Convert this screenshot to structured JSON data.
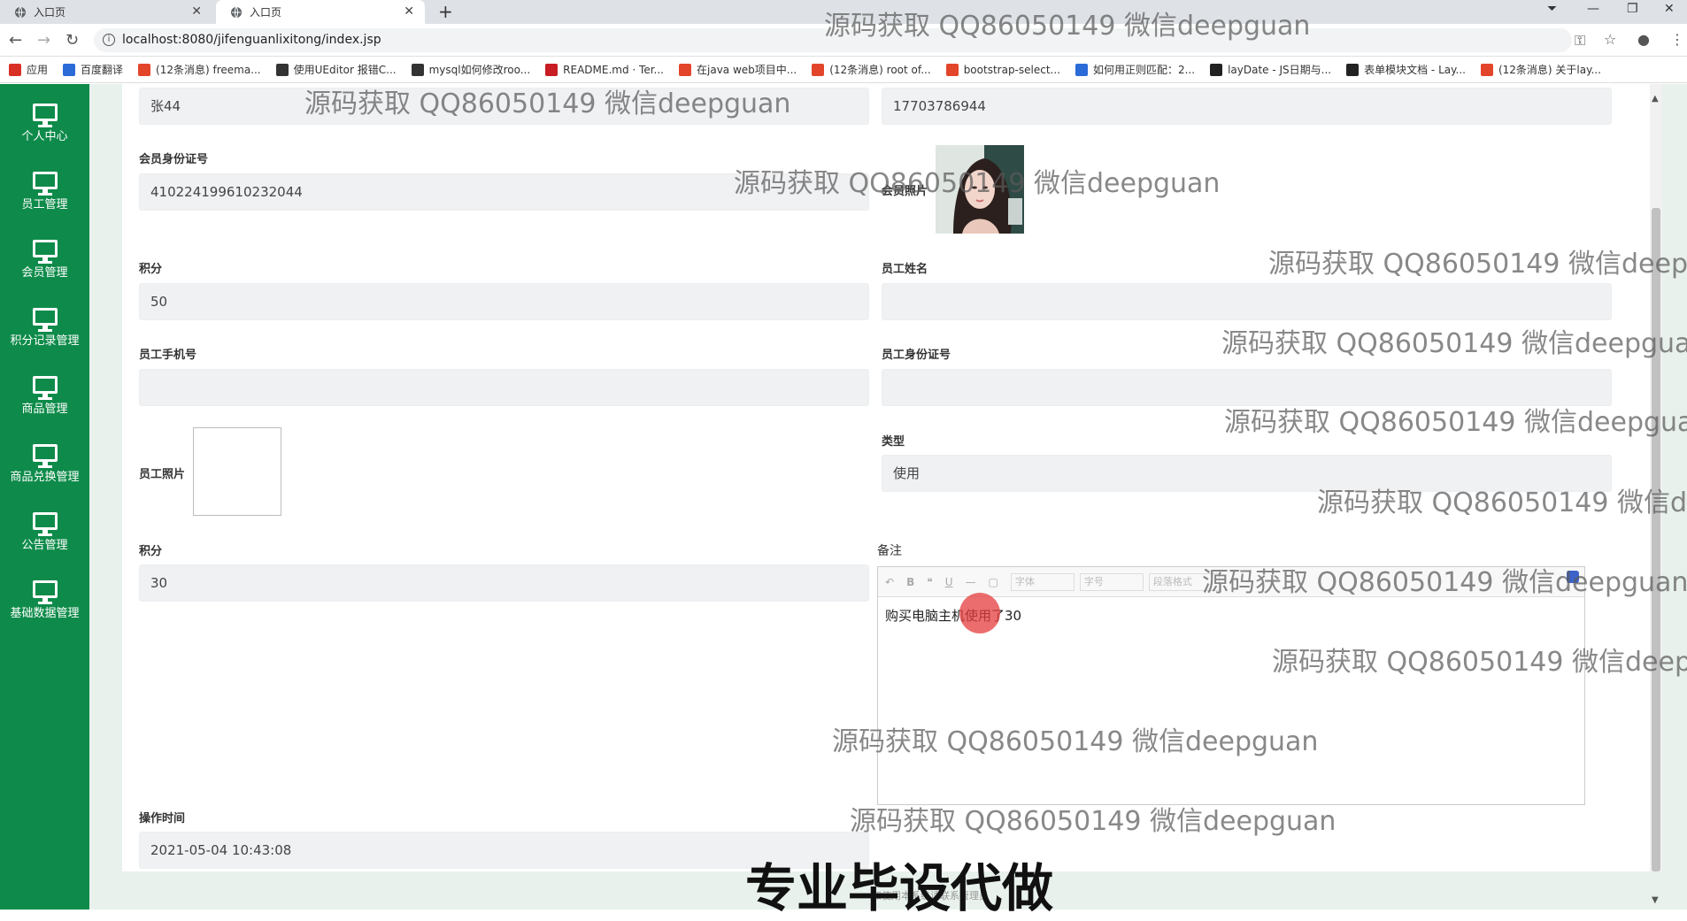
{
  "browser": {
    "tabs": [
      {
        "title": "入口页",
        "active": false
      },
      {
        "title": "入口页",
        "active": true
      }
    ],
    "url": "localhost:8080/jifenguanlixitong/index.jsp",
    "bookmarks": [
      {
        "label": "应用",
        "icon": "apps-grid-icon",
        "color": "#d93025"
      },
      {
        "label": "百度翻译",
        "icon": "baidu-translate-icon",
        "color": "#2b6bd8"
      },
      {
        "label": "(12条消息) freema...",
        "icon": "csdn-icon",
        "color": "#e3452a"
      },
      {
        "label": "使用UEditor 报错C...",
        "icon": "ueditor-icon",
        "color": "#333333"
      },
      {
        "label": "mysql如何修改roo...",
        "icon": "ueditor-icon",
        "color": "#333333"
      },
      {
        "label": "README.md · Ter...",
        "icon": "gitee-icon",
        "color": "#c71d23"
      },
      {
        "label": "在java web项目中...",
        "icon": "csdn-icon",
        "color": "#e3452a"
      },
      {
        "label": "(12条消息) root of...",
        "icon": "csdn-icon",
        "color": "#e3452a"
      },
      {
        "label": "bootstrap-select...",
        "icon": "bootstrap-icon",
        "color": "#e3452a"
      },
      {
        "label": "如何用正则匹配：2...",
        "icon": "baidu-paw-icon",
        "color": "#2b6bd8"
      },
      {
        "label": "layDate - JS日期与...",
        "icon": "layui-icon",
        "color": "#222222"
      },
      {
        "label": "表单模块文档 - Lay...",
        "icon": "layui-icon",
        "color": "#222222"
      },
      {
        "label": "(12条消息) 关于lay...",
        "icon": "csdn-icon",
        "color": "#e3452a"
      }
    ]
  },
  "sidebar": {
    "items": [
      {
        "label": "个人中心"
      },
      {
        "label": "员工管理"
      },
      {
        "label": "会员管理"
      },
      {
        "label": "积分记录管理"
      },
      {
        "label": "商品管理"
      },
      {
        "label": "商品兑换管理"
      },
      {
        "label": "公告管理"
      },
      {
        "label": "基础数据管理"
      }
    ],
    "color": "#0e8b4a"
  },
  "form": {
    "member_name_value": "张44",
    "member_phone_value": "17703786944",
    "member_idcard_label": "会员身份证号",
    "member_idcard_value": "410224199610232044",
    "member_photo_label": "会员照片",
    "points_label": "积分",
    "points_value": "50",
    "staff_name_label": "员工姓名",
    "staff_name_value": "",
    "staff_phone_label": "员工手机号",
    "staff_phone_value": "",
    "staff_idcard_label": "员工身份证号",
    "staff_idcard_value": "",
    "staff_photo_label": "员工照片",
    "type_label": "类型",
    "type_value": "使用",
    "points2_label": "积分",
    "points2_value": "30",
    "remark_label": "备注",
    "remark_value": "购买电脑主机使用了30",
    "time_label": "操作时间",
    "time_value": "2021-05-04 10:43:08"
  },
  "editor": {
    "toolbar": [
      "↶",
      "B",
      "❝",
      "U",
      "—",
      "▢"
    ],
    "font_select": "字体",
    "size_select": "字号",
    "para_select": "段落格式"
  },
  "watermark_text": "源码获取 QQ86050149 微信deepguan",
  "promo_text": "专业毕设代做",
  "footer_hint": "如使用本系统请联系管理员"
}
